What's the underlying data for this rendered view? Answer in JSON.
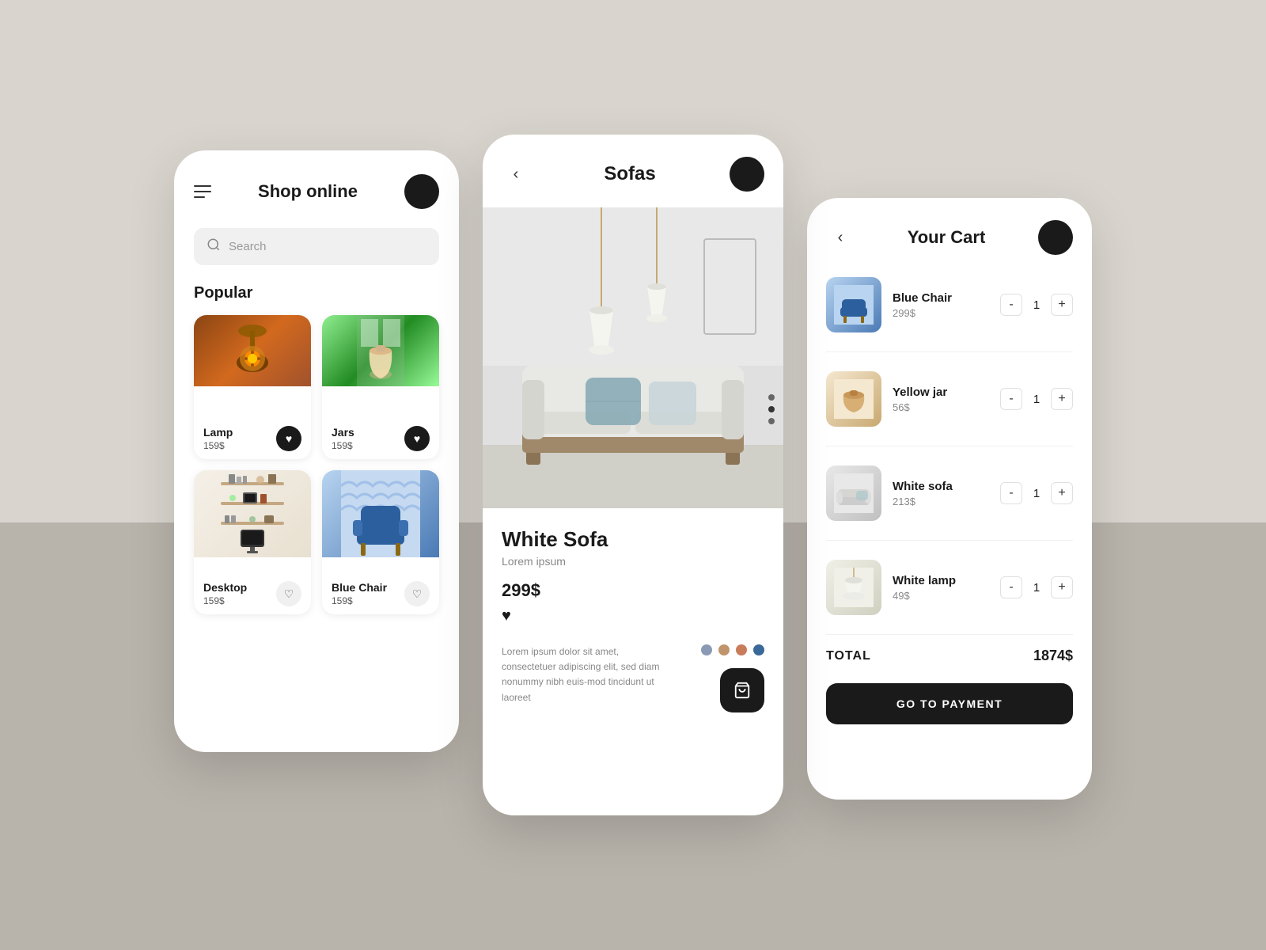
{
  "screen1": {
    "header": {
      "title": "Shop online",
      "avatar_label": "user-avatar"
    },
    "search": {
      "placeholder": "Search"
    },
    "popular": {
      "label": "Popular",
      "products": [
        {
          "name": "Lamp",
          "price": "159$",
          "heart": true,
          "emoji": "🪔"
        },
        {
          "name": "Jars",
          "price": "159$",
          "heart": true,
          "emoji": "🏺"
        },
        {
          "name": "Desktop",
          "price": "159$",
          "heart": false,
          "emoji": "🖥️"
        },
        {
          "name": "Blue Chair",
          "price": "159$",
          "heart": false,
          "emoji": "🪑"
        }
      ]
    }
  },
  "screen2": {
    "header": {
      "title": "Sofas",
      "back_label": "‹"
    },
    "product": {
      "name": "White Sofa",
      "description": "Lorem ipsum",
      "price": "299$",
      "lorem": "Lorem ipsum dolor sit amet, consectetuer adipiscing elit, sed diam nonummy nibh euis-mod tincidunt ut laoreet"
    },
    "colors": [
      {
        "hex": "#8a9ab5"
      },
      {
        "hex": "#c0956e"
      },
      {
        "hex": "#c87c5a"
      },
      {
        "hex": "#3a6898"
      }
    ]
  },
  "screen3": {
    "header": {
      "title": "Your Cart"
    },
    "items": [
      {
        "name": "Blue Chair",
        "price": "299$",
        "qty": 1,
        "emoji": "🪑",
        "bg": "#b8d4f0"
      },
      {
        "name": "Yellow jar",
        "price": "56$",
        "qty": 1,
        "emoji": "🏺",
        "bg": "#f5e8d0"
      },
      {
        "name": "White sofa",
        "price": "213$",
        "qty": 1,
        "emoji": "🛋️",
        "bg": "#e8e8e8"
      },
      {
        "name": "White lamp",
        "price": "49$",
        "qty": 1,
        "emoji": "💡",
        "bg": "#f0f0e8"
      }
    ],
    "total_label": "TOTAL",
    "total_amount": "1874$",
    "payment_btn": "GO TO PAYMENT"
  }
}
